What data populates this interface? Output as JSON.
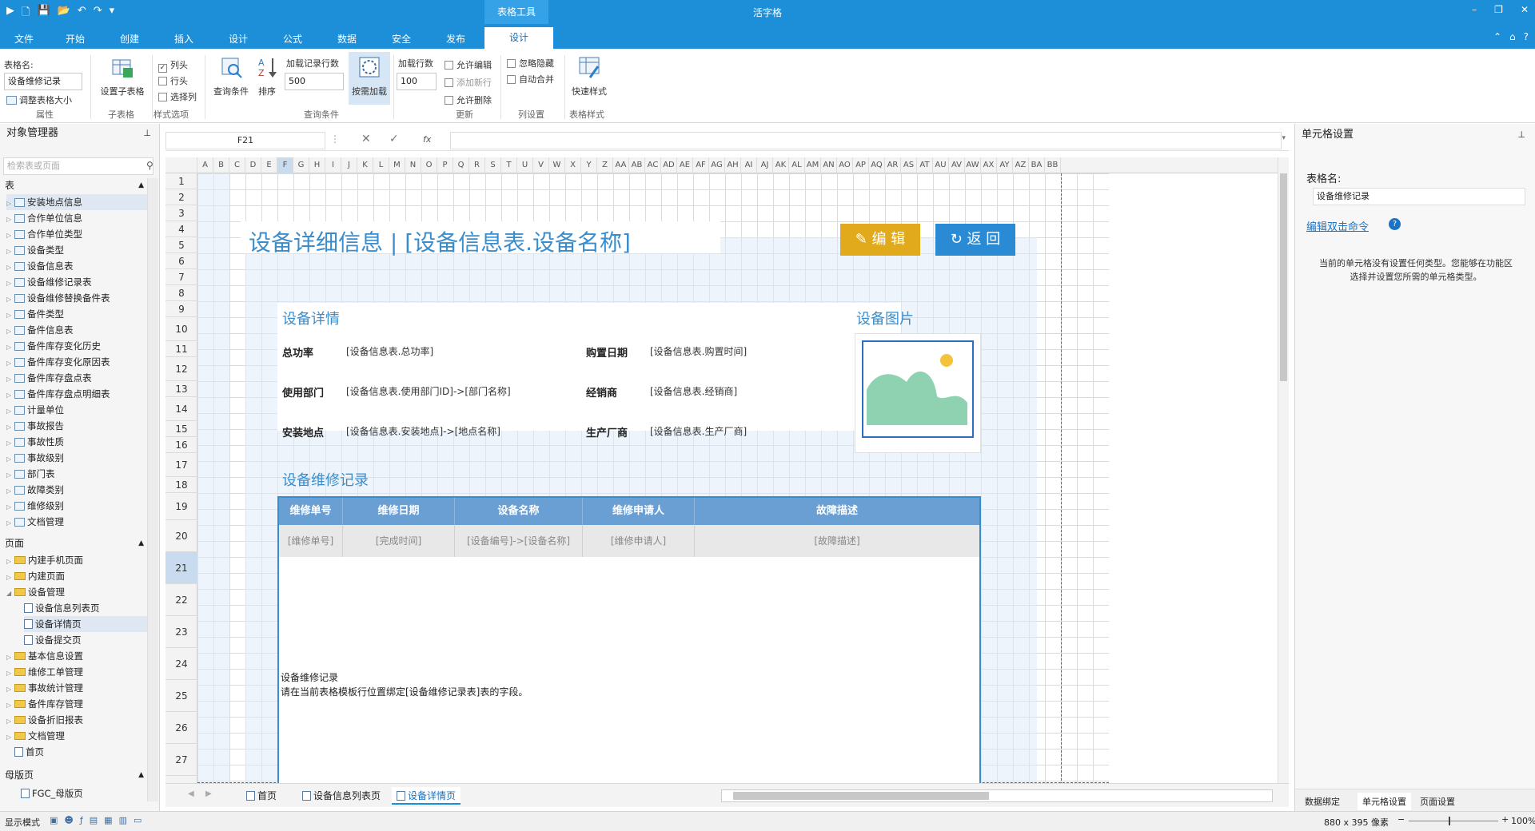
{
  "window": {
    "title": "活字格",
    "context_tab": "表格工具",
    "controls": [
      "–",
      "❐",
      "✕"
    ]
  },
  "menu": {
    "items": [
      "文件",
      "开始",
      "创建",
      "插入",
      "设计",
      "公式",
      "数据",
      "安全",
      "发布"
    ],
    "active": "设计",
    "right_icons": [
      "⌃",
      "⌂",
      "?"
    ]
  },
  "ribbon": {
    "table_name_label": "表格名:",
    "table_name_value": "设备维修记录",
    "adjust_size": "调整表格大小",
    "group_props": "属性",
    "subtable_btn": "设置子表格",
    "group_subtable": "子表格",
    "col_header": "列头",
    "row_header": "行头",
    "select_col": "选择列",
    "group_style_opts": "样式选项",
    "query_cond": "查询条件",
    "sort": "排序",
    "load_rows_label": "加载记录行数",
    "load_rows_value": "500",
    "load_on_demand": "按需加载",
    "group_query": "查询条件",
    "load_row_count_label": "加载行数",
    "load_row_count_value": "100",
    "allow_edit": "允许编辑",
    "add_new_row": "添加新行",
    "allow_delete": "允许删除",
    "group_update": "更新",
    "ignore_hidden": "忽略隐藏",
    "auto_merge": "自动合并",
    "group_colset": "列设置",
    "quick_style": "快速样式",
    "group_table_style": "表格样式"
  },
  "left_panel": {
    "title": "对象管理器",
    "search_placeholder": "检索表或页面",
    "section_tables": "表",
    "tables": [
      "安装地点信息",
      "合作单位信息",
      "合作单位类型",
      "设备类型",
      "设备信息表",
      "设备维修记录表",
      "设备维修替换备件表",
      "备件类型",
      "备件信息表",
      "备件库存变化历史",
      "备件库存变化原因表",
      "备件库存盘点表",
      "备件库存盘点明细表",
      "计量单位",
      "事故报告",
      "事故性质",
      "事故级别",
      "部门表",
      "故障类别",
      "维修级别",
      "文档管理"
    ],
    "section_pages": "页面",
    "pages": [
      {
        "label": "内建手机页面",
        "level": 0,
        "folder": true
      },
      {
        "label": "内建页面",
        "level": 0,
        "folder": true
      },
      {
        "label": "设备管理",
        "level": 0,
        "folder": true
      },
      {
        "label": "设备信息列表页",
        "level": 1,
        "folder": false
      },
      {
        "label": "设备详情页",
        "level": 1,
        "folder": false
      },
      {
        "label": "设备提交页",
        "level": 1,
        "folder": false
      },
      {
        "label": "基本信息设置",
        "level": 0,
        "folder": true
      },
      {
        "label": "维修工单管理",
        "level": 0,
        "folder": true
      },
      {
        "label": "事故统计管理",
        "level": 0,
        "folder": true
      },
      {
        "label": "备件库存管理",
        "level": 0,
        "folder": true
      },
      {
        "label": "设备折旧报表",
        "level": 0,
        "folder": true
      },
      {
        "label": "文档管理",
        "level": 0,
        "folder": true
      },
      {
        "label": "首页",
        "level": 0,
        "folder": false
      }
    ],
    "section_master": "母版页",
    "master_pages": [
      "FGC_母版页"
    ]
  },
  "formula": {
    "cell_ref": "F21",
    "cancel": "✕",
    "confirm": "✓",
    "fx": "fx",
    "value": ""
  },
  "grid": {
    "columns": [
      "A",
      "B",
      "C",
      "D",
      "E",
      "F",
      "G",
      "H",
      "I",
      "J",
      "K",
      "L",
      "M",
      "N",
      "O",
      "P",
      "Q",
      "R",
      "S",
      "T",
      "U",
      "V",
      "W",
      "X",
      "Y",
      "Z",
      "AA",
      "AB",
      "AC",
      "AD",
      "AE",
      "AF",
      "AG",
      "AH",
      "AI",
      "AJ",
      "AK",
      "AL",
      "AM",
      "AN",
      "AO",
      "AP",
      "AQ",
      "AR",
      "AS",
      "AT",
      "AU",
      "AV",
      "AW",
      "AX",
      "AY",
      "AZ",
      "BA",
      "BB"
    ],
    "rows": [
      "1",
      "2",
      "3",
      "4",
      "5",
      "6",
      "7",
      "8",
      "9",
      "10",
      "11",
      "12",
      "13",
      "14",
      "15",
      "16",
      "17",
      "18",
      "19",
      "20",
      "21",
      "22",
      "23",
      "24",
      "25",
      "26",
      "27"
    ]
  },
  "doc": {
    "page_title": "设备详细信息 | [设备信息表.设备名称]",
    "edit_btn": "编 辑",
    "back_btn": "返 回",
    "detail_heading": "设备详情",
    "image_heading": "设备图片",
    "fields": [
      {
        "label": "总功率",
        "value": "[设备信息表.总功率]"
      },
      {
        "label": "购置日期",
        "value": "[设备信息表.购置时间]"
      },
      {
        "label": "使用部门",
        "value": "[设备信息表.使用部门ID]->[部门名称]"
      },
      {
        "label": "经销商",
        "value": "[设备信息表.经销商]"
      },
      {
        "label": "安装地点",
        "value": "[设备信息表.安装地点]->[地点名称]"
      },
      {
        "label": "生产厂商",
        "value": "[设备信息表.生产厂商]"
      }
    ],
    "repair_heading": "设备维修记录",
    "table_headers": [
      "维修单号",
      "维修日期",
      "设备名称",
      "维修申请人",
      "故障描述"
    ],
    "table_row": [
      "[维修单号]",
      "[完成时间]",
      "[设备编号]->[设备名称]",
      "[维修申请人]",
      "[故障描述]"
    ],
    "hint_line1": "设备维修记录",
    "hint_line2": "请在当前表格模板行位置绑定[设备维修记录表]表的字段。"
  },
  "sheet_tabs": [
    "首页",
    "设备信息列表页",
    "设备详情页"
  ],
  "active_sheet_tab": "设备详情页",
  "right_panel": {
    "title": "单元格设置",
    "table_name_label": "表格名:",
    "table_name_value": "设备维修记录",
    "dblclick_link": "编辑双击命令",
    "info_text": "当前的单元格没有设置任何类型。您能够在功能区选择并设置您所需的单元格类型。",
    "bottom_tabs": [
      "数据绑定",
      "单元格设置",
      "页面设置"
    ]
  },
  "status": {
    "mode": "显示模式",
    "size": "880 x 395 像素",
    "zoom": "100%"
  },
  "colors": {
    "brand": "#1c8fd8",
    "edit_btn": "#e0aa1c",
    "back_btn": "#2a8bd4",
    "heading": "#3a8dcc",
    "table_header": "#6a9fd4"
  }
}
